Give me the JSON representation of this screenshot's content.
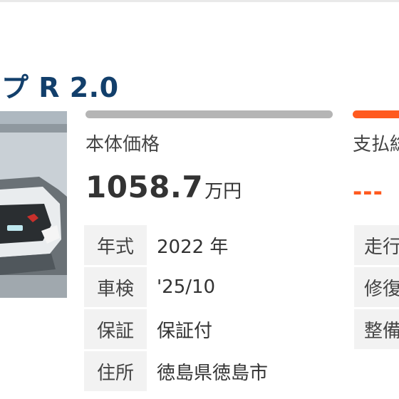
{
  "title": "プ R 2.0",
  "left_panel": {
    "price_label": "本体価格",
    "price_value": "1058.7",
    "price_unit": "万円",
    "specs": [
      {
        "key": "年式",
        "value": "2022 年"
      },
      {
        "key": "車検",
        "value": "'25/10"
      },
      {
        "key": "保証",
        "value": "保証付"
      },
      {
        "key": "住所",
        "value": "徳島県徳島市"
      }
    ]
  },
  "right_panel": {
    "payment_label": "支払総",
    "payment_value": "---",
    "specs": [
      "走行",
      "修復",
      "整備"
    ]
  },
  "colors": {
    "title": "#123f6b",
    "accent": "#ff5a1f",
    "bar_gray": "#b5b5b5",
    "label_bg": "#f2f2f2"
  }
}
